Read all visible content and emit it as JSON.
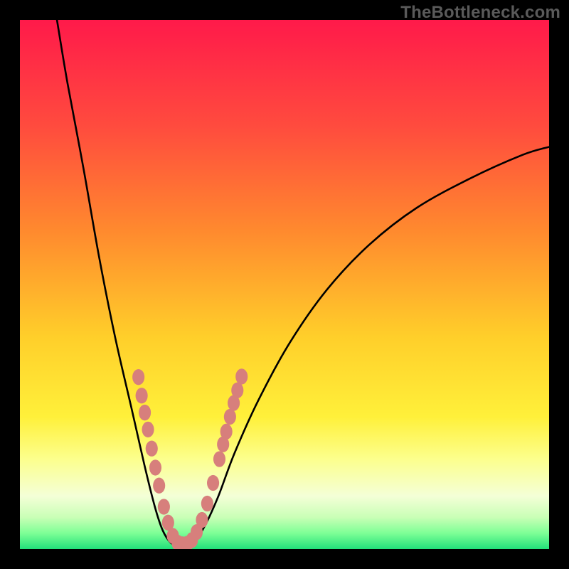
{
  "watermark": "TheBottleneck.com",
  "chart_data": {
    "type": "line",
    "title": "",
    "xlabel": "",
    "ylabel": "",
    "xlim": [
      0,
      100
    ],
    "ylim": [
      0,
      100
    ],
    "background_gradient": {
      "stops": [
        {
          "pos": 0.0,
          "color": "#ff1a4a"
        },
        {
          "pos": 0.2,
          "color": "#ff4b3e"
        },
        {
          "pos": 0.4,
          "color": "#ff8a2e"
        },
        {
          "pos": 0.6,
          "color": "#ffcf2a"
        },
        {
          "pos": 0.75,
          "color": "#fff03a"
        },
        {
          "pos": 0.83,
          "color": "#fcff8d"
        },
        {
          "pos": 0.9,
          "color": "#f4ffd7"
        },
        {
          "pos": 0.94,
          "color": "#c9ffb6"
        },
        {
          "pos": 0.97,
          "color": "#7dff96"
        },
        {
          "pos": 1.0,
          "color": "#22e07a"
        }
      ]
    },
    "series": [
      {
        "name": "bottleneck-curve",
        "points": [
          {
            "x": 7.0,
            "y": 100.0
          },
          {
            "x": 9.0,
            "y": 88.0
          },
          {
            "x": 12.0,
            "y": 72.0
          },
          {
            "x": 15.0,
            "y": 55.0
          },
          {
            "x": 18.0,
            "y": 40.0
          },
          {
            "x": 21.0,
            "y": 27.0
          },
          {
            "x": 23.5,
            "y": 16.0
          },
          {
            "x": 25.5,
            "y": 8.0
          },
          {
            "x": 27.0,
            "y": 3.5
          },
          {
            "x": 28.5,
            "y": 1.2
          },
          {
            "x": 30.0,
            "y": 0.5
          },
          {
            "x": 31.5,
            "y": 0.5
          },
          {
            "x": 33.0,
            "y": 1.4
          },
          {
            "x": 35.0,
            "y": 4.5
          },
          {
            "x": 37.5,
            "y": 10.0
          },
          {
            "x": 40.5,
            "y": 18.0
          },
          {
            "x": 45.0,
            "y": 28.0
          },
          {
            "x": 51.0,
            "y": 39.0
          },
          {
            "x": 58.0,
            "y": 49.0
          },
          {
            "x": 66.0,
            "y": 57.5
          },
          {
            "x": 75.0,
            "y": 64.5
          },
          {
            "x": 85.0,
            "y": 70.0
          },
          {
            "x": 95.0,
            "y": 74.5
          },
          {
            "x": 100.0,
            "y": 76.0
          }
        ]
      }
    ],
    "markers": [
      {
        "x": 22.4,
        "y": 32.5
      },
      {
        "x": 23.0,
        "y": 29.0
      },
      {
        "x": 23.6,
        "y": 25.8
      },
      {
        "x": 24.2,
        "y": 22.6
      },
      {
        "x": 24.9,
        "y": 19.0
      },
      {
        "x": 25.6,
        "y": 15.4
      },
      {
        "x": 26.3,
        "y": 12.0
      },
      {
        "x": 27.2,
        "y": 8.0
      },
      {
        "x": 28.0,
        "y": 5.0
      },
      {
        "x": 28.9,
        "y": 2.5
      },
      {
        "x": 29.8,
        "y": 1.2
      },
      {
        "x": 30.7,
        "y": 0.9
      },
      {
        "x": 31.6,
        "y": 1.0
      },
      {
        "x": 32.5,
        "y": 1.7
      },
      {
        "x": 33.4,
        "y": 3.2
      },
      {
        "x": 34.4,
        "y": 5.5
      },
      {
        "x": 35.4,
        "y": 8.6
      },
      {
        "x": 36.5,
        "y": 12.5
      },
      {
        "x": 37.7,
        "y": 17.0
      },
      {
        "x": 38.4,
        "y": 19.8
      },
      {
        "x": 39.0,
        "y": 22.2
      },
      {
        "x": 39.7,
        "y": 25.0
      },
      {
        "x": 40.4,
        "y": 27.6
      },
      {
        "x": 41.1,
        "y": 30.0
      },
      {
        "x": 41.9,
        "y": 32.6
      }
    ]
  }
}
